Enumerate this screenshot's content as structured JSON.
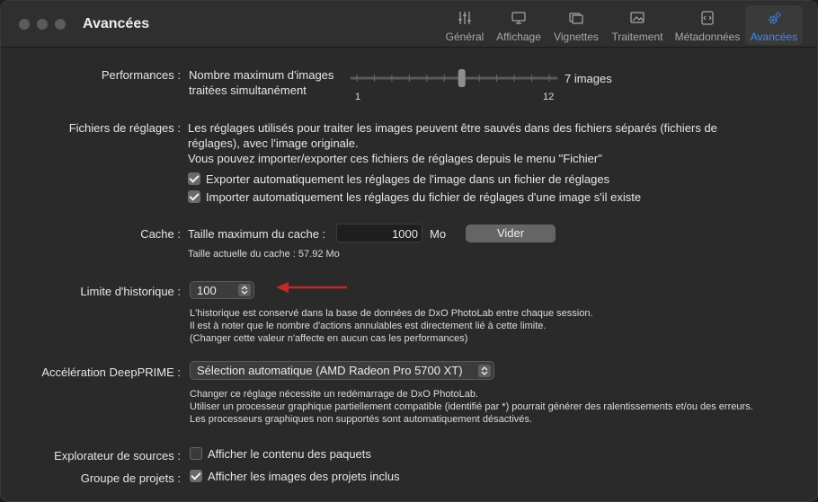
{
  "window": {
    "title": "Avancées"
  },
  "tabs": [
    {
      "label": "Général",
      "icon": "sliders-icon",
      "active": false
    },
    {
      "label": "Affichage",
      "icon": "monitor-icon",
      "active": false
    },
    {
      "label": "Vignettes",
      "icon": "thumbnails-icon",
      "active": false
    },
    {
      "label": "Traitement",
      "icon": "processing-icon",
      "active": false
    },
    {
      "label": "Métadonnées",
      "icon": "metadata-icon",
      "active": false
    },
    {
      "label": "Avancées",
      "icon": "gears-icon",
      "active": true
    }
  ],
  "performances": {
    "label": "Performances :",
    "description_line1": "Nombre maximum d'images",
    "description_line2": "traitées simultanément",
    "slider_min_label": "1",
    "slider_max_label": "12",
    "slider_min": 1,
    "slider_max": 12,
    "slider_value": 7,
    "value_text": "7 images"
  },
  "settings_files": {
    "label": "Fichiers de réglages :",
    "text_line1": "Les réglages utilisés pour traiter les images peuvent être sauvés dans des fichiers séparés (fichiers de",
    "text_line2": "réglages), avec l'image originale.",
    "text_line3": "Vous pouvez importer/exporter ces fichiers de réglages depuis le menu \"Fichier\"",
    "export_label": "Exporter automatiquement les réglages de l'image dans un fichier de réglages",
    "export_checked": true,
    "import_label": "Importer automatiquement les réglages du fichier de réglages d'une image s'il existe",
    "import_checked": true
  },
  "cache": {
    "label": "Cache :",
    "max_label": "Taille maximum du cache :",
    "max_value": "1000",
    "unit": "Mo",
    "clear_button": "Vider",
    "current_size": "Taille actuelle du cache : 57.92 Mo"
  },
  "history": {
    "label": "Limite d'historique :",
    "value": "100",
    "note_line1": "L'historique est conservé dans la base de données de DxO PhotoLab entre chaque session.",
    "note_line2": "Il est à noter que le nombre d'actions annulables est directement lié à cette limite.",
    "note_line3": "(Changer cette valeur n'affecte en aucun cas les performances)",
    "arrow_color": "#c62828"
  },
  "deepprime": {
    "label": "Accélération DeepPRIME :",
    "selected": "Sélection automatique (AMD Radeon Pro 5700 XT)",
    "note_line1": "Changer ce réglage nécessite un redémarrage de DxO PhotoLab.",
    "note_line2": "Utiliser un processeur graphique partiellement compatible (identifié par *) pourrait générer des ralentissements et/ou des erreurs.",
    "note_line3": "Les processeurs graphiques non supportés sont automatiquement désactivés."
  },
  "sources": {
    "label": "Explorateur de sources :",
    "option": "Afficher le contenu des paquets",
    "checked": false
  },
  "projects": {
    "label": "Groupe de projets :",
    "option": "Afficher les images des projets inclus",
    "checked": true
  },
  "colors": {
    "accent": "#3d8cf0",
    "window_bg": "#2a2a2a",
    "titlebar_bg": "#2f2f2f"
  }
}
